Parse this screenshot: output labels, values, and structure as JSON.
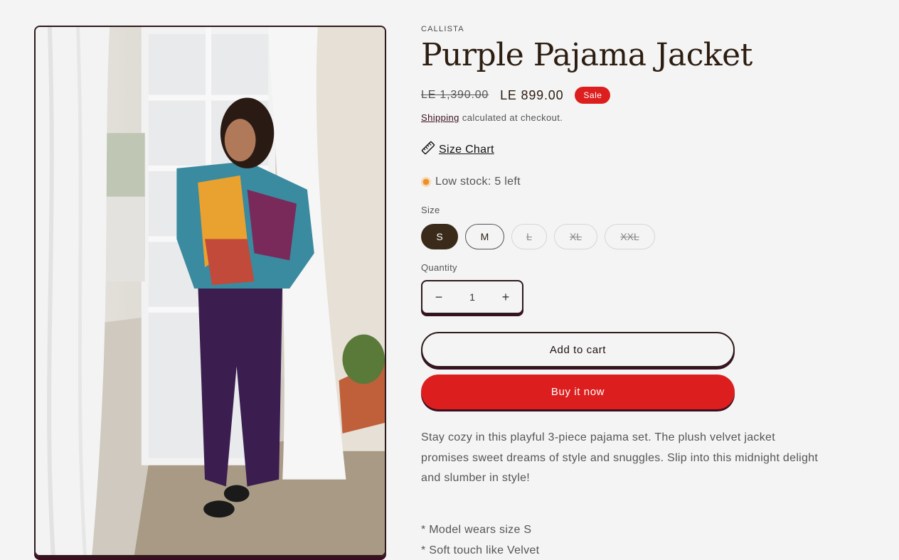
{
  "product": {
    "vendor": "CALLISTA",
    "title": "Purple Pajama Jacket",
    "price_regular": "LE 1,390.00",
    "price_sale": "LE 899.00",
    "badge": "Sale",
    "shipping_link": "Shipping",
    "shipping_text": " calculated at checkout.",
    "size_chart": "Size Chart",
    "stock": "Low stock: 5 left"
  },
  "size": {
    "label": "Size",
    "options": [
      {
        "label": "S",
        "state": "selected"
      },
      {
        "label": "M",
        "state": "available"
      },
      {
        "label": "L",
        "state": "unavailable"
      },
      {
        "label": "XL",
        "state": "unavailable"
      },
      {
        "label": "XXL",
        "state": "unavailable"
      }
    ]
  },
  "quantity": {
    "label": "Quantity",
    "value": "1",
    "minus": "−",
    "plus": "+"
  },
  "buttons": {
    "add_to_cart": "Add to cart",
    "buy_now": "Buy it now"
  },
  "description": {
    "text": "Stay cozy in this playful 3-piece pajama set. The plush velvet jacket promises sweet dreams of style and snuggles. Slip into this midnight delight and slumber in style!",
    "bullets": [
      "* Model wears size S",
      "* Soft touch like Velvet"
    ]
  },
  "colors": {
    "accent": "#dc1e1e",
    "outline": "#2e1a1a",
    "selected": "#3a2a1a",
    "stock_dot": "#e8902c"
  }
}
